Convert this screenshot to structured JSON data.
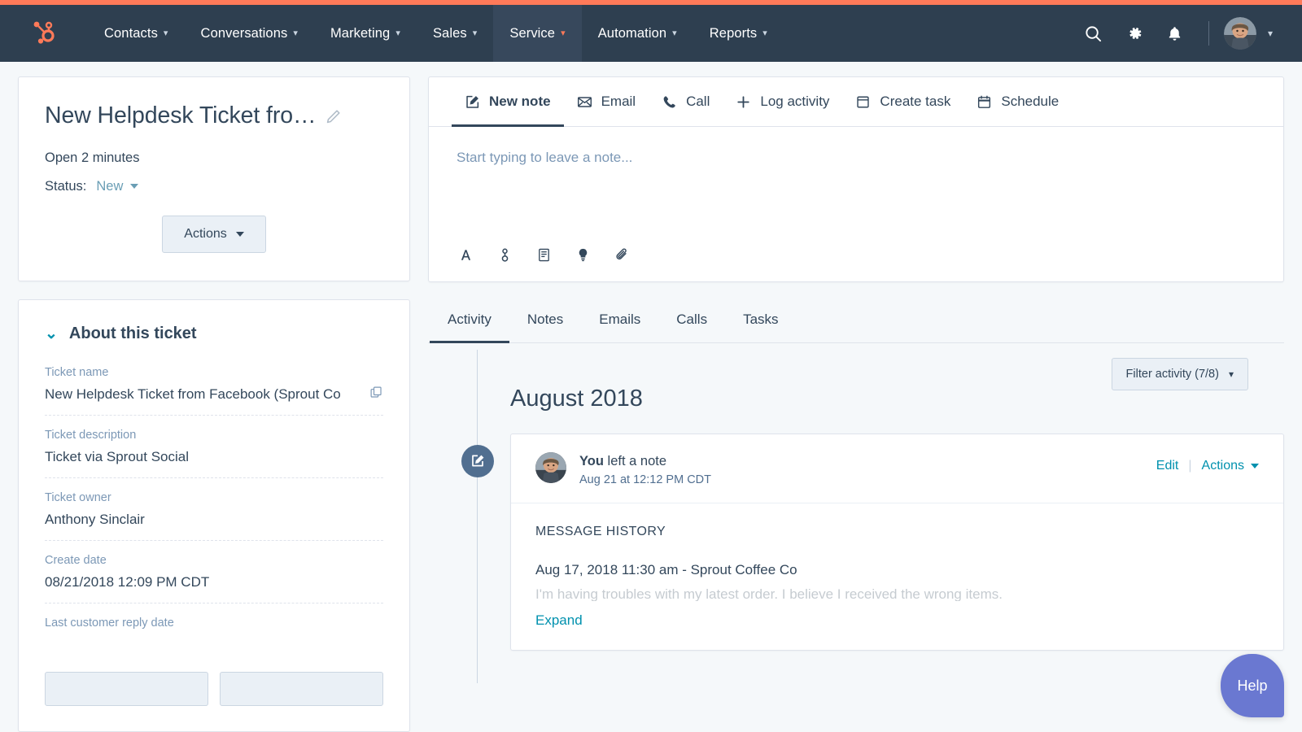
{
  "nav": {
    "logo_icon": "hubspot-sprocket-logo",
    "items": [
      {
        "label": "Contacts",
        "active": false
      },
      {
        "label": "Conversations",
        "active": false
      },
      {
        "label": "Marketing",
        "active": false
      },
      {
        "label": "Sales",
        "active": false
      },
      {
        "label": "Service",
        "active": true
      },
      {
        "label": "Automation",
        "active": false
      },
      {
        "label": "Reports",
        "active": false
      }
    ],
    "icons": {
      "search": "search-icon",
      "settings": "gear-icon",
      "notifications": "bell-icon"
    },
    "avatar_alt": "user-avatar"
  },
  "ticket": {
    "title": "New Helpdesk Ticket fro…",
    "edit_icon": "pencil-icon",
    "open_duration": "Open 2 minutes",
    "status_label": "Status:",
    "status_value": "New",
    "actions_label": "Actions"
  },
  "about": {
    "section_title": "About this ticket",
    "fields": [
      {
        "label": "Ticket name",
        "value": "New Helpdesk Ticket from Facebook (Sprout Co"
      },
      {
        "label": "Ticket description",
        "value": "Ticket via Sprout Social"
      },
      {
        "label": "Ticket owner",
        "value": "Anthony Sinclair"
      },
      {
        "label": "Create date",
        "value": "08/21/2018 12:09 PM CDT"
      },
      {
        "label": "Last customer reply date",
        "value": ""
      }
    ]
  },
  "composer": {
    "tabs": [
      {
        "label": "New note",
        "icon": "note-pencil-icon",
        "active": true
      },
      {
        "label": "Email",
        "icon": "envelope-icon",
        "active": false
      },
      {
        "label": "Call",
        "icon": "phone-icon",
        "active": false
      },
      {
        "label": "Log activity",
        "icon": "plus-icon",
        "active": false
      },
      {
        "label": "Create task",
        "icon": "task-card-icon",
        "active": false
      },
      {
        "label": "Schedule",
        "icon": "calendar-icon",
        "active": false
      }
    ],
    "placeholder": "Start typing to leave a note...",
    "toolbar_icons": [
      "font-format-icon",
      "insert-contact-icon",
      "document-template-icon",
      "knowledge-lightbulb-icon",
      "attachment-paperclip-icon"
    ]
  },
  "activity": {
    "tabs": [
      {
        "label": "Activity",
        "active": true
      },
      {
        "label": "Notes",
        "active": false
      },
      {
        "label": "Emails",
        "active": false
      },
      {
        "label": "Calls",
        "active": false
      },
      {
        "label": "Tasks",
        "active": false
      }
    ],
    "filter_label": "Filter activity (7/8)",
    "month_heading": "August 2018",
    "events": [
      {
        "badge_icon": "note-pencil-icon",
        "actor": "You",
        "action": " left a note",
        "timestamp": "Aug 21 at 12:12 PM CDT",
        "edit_label": "Edit",
        "actions_label": "Actions",
        "body_label": "MESSAGE HISTORY",
        "message_header": "Aug 17, 2018 11:30 am - Sprout Coffee Co",
        "message_preview": "I'm having troubles with my latest order. I believe I received the wrong items.",
        "expand_label": "Expand"
      }
    ]
  },
  "help": {
    "label": "Help"
  },
  "colors": {
    "brand_orange": "#ff7a59",
    "nav_navy": "#2e3f50",
    "nav_active": "#37485c",
    "text_primary": "#33475b",
    "text_muted": "#7c98b6",
    "link_teal": "#0091ae",
    "page_bg": "#f5f8fa",
    "border": "#dfe3eb",
    "badge_slate": "#516f90",
    "help_purple": "#6a78d1"
  }
}
